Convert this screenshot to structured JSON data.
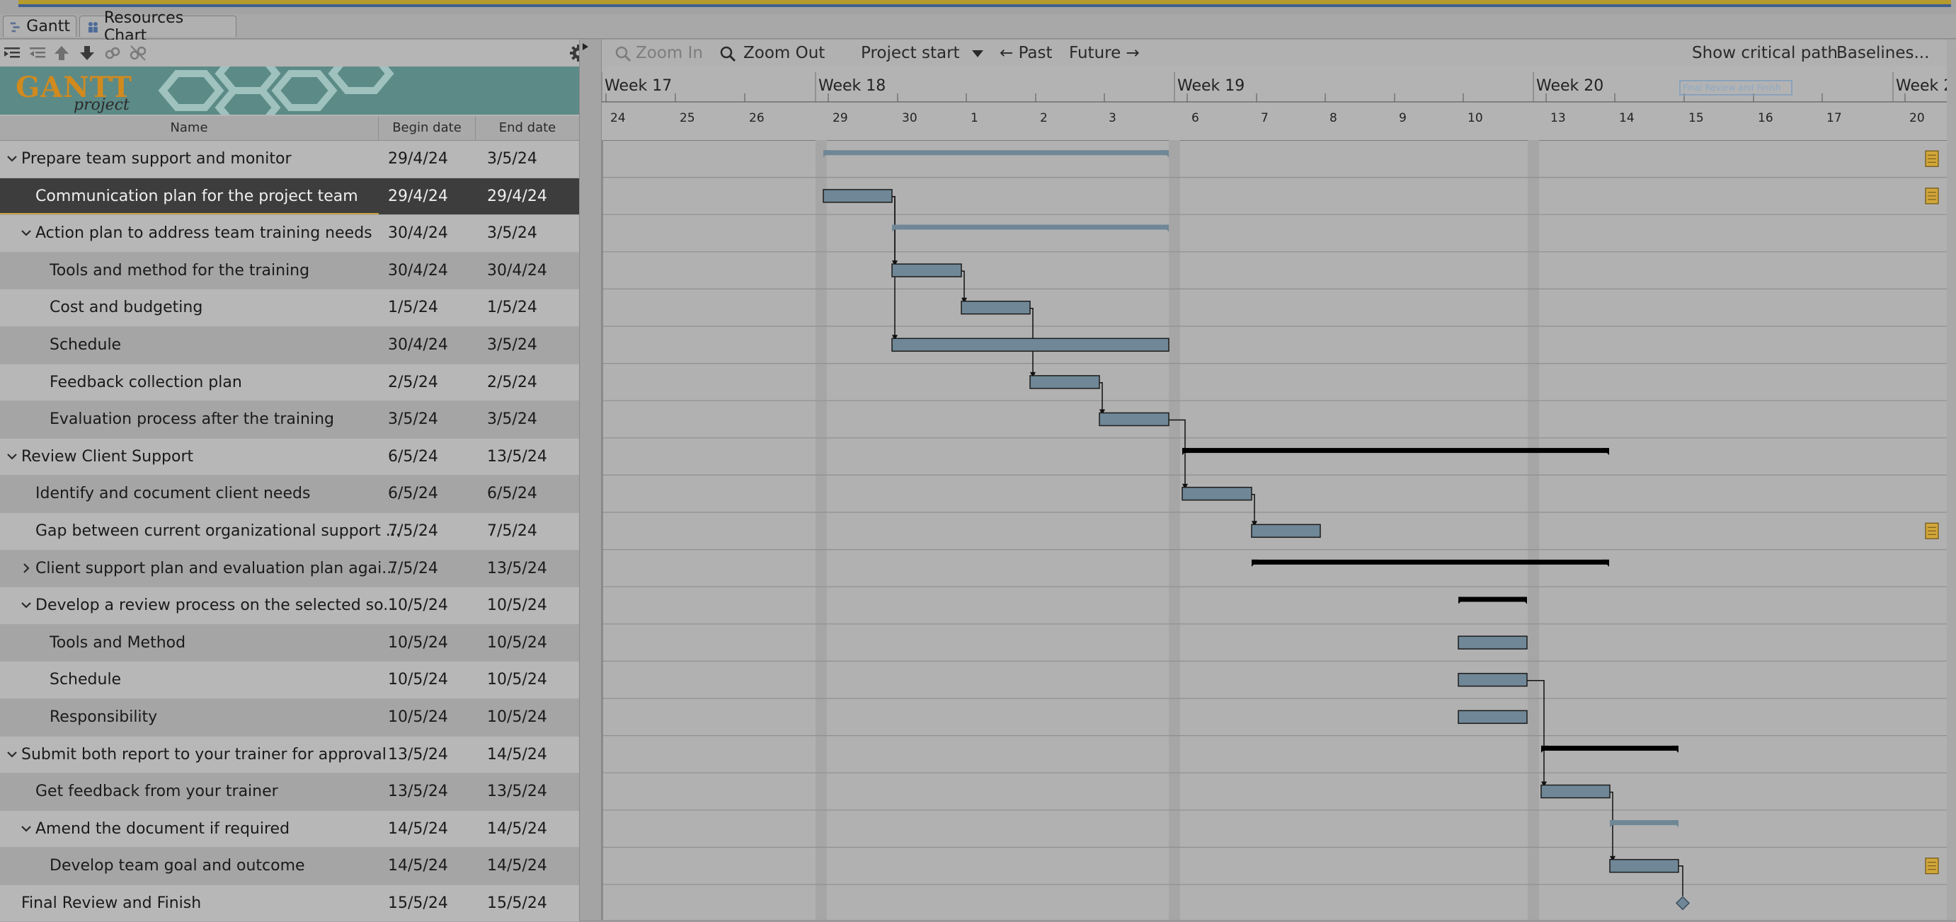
{
  "tabs": [
    {
      "label": "Gantt",
      "icon": "gantt-icon"
    },
    {
      "label": "Resources Chart",
      "icon": "resources-icon"
    }
  ],
  "toolbar": {
    "icons": [
      "indent-icon",
      "outdent-icon",
      "move-up-icon",
      "move-down-icon",
      "link-icon",
      "unlink-icon"
    ],
    "settings_icon": "gear-icon"
  },
  "logo": {
    "word": "GANTT",
    "sub": "project"
  },
  "columns": {
    "name": "Name",
    "begin": "Begin date",
    "end": "End date"
  },
  "tasks": [
    {
      "name": "Prepare team support and monitor",
      "begin": "29/4/24",
      "end": "3/5/24",
      "level": 0,
      "expander": "down",
      "selected": false
    },
    {
      "name": "Communication plan for the project team",
      "begin": "29/4/24",
      "end": "29/4/24",
      "level": 1,
      "expander": "none",
      "selected": true
    },
    {
      "name": "Action plan to address team training needs",
      "begin": "30/4/24",
      "end": "3/5/24",
      "level": 1,
      "expander": "down",
      "selected": false
    },
    {
      "name": "Tools and method for the training",
      "begin": "30/4/24",
      "end": "30/4/24",
      "level": 2,
      "expander": "none",
      "selected": false
    },
    {
      "name": "Cost and budgeting",
      "begin": "1/5/24",
      "end": "1/5/24",
      "level": 2,
      "expander": "none",
      "selected": false
    },
    {
      "name": "Schedule",
      "begin": "30/4/24",
      "end": "3/5/24",
      "level": 2,
      "expander": "none",
      "selected": false
    },
    {
      "name": "Feedback collection plan",
      "begin": "2/5/24",
      "end": "2/5/24",
      "level": 2,
      "expander": "none",
      "selected": false
    },
    {
      "name": "Evaluation process after the training",
      "begin": "3/5/24",
      "end": "3/5/24",
      "level": 2,
      "expander": "none",
      "selected": false
    },
    {
      "name": "Review Client Support",
      "begin": "6/5/24",
      "end": "13/5/24",
      "level": 0,
      "expander": "down",
      "selected": false
    },
    {
      "name": "Identify and cocument client needs",
      "begin": "6/5/24",
      "end": "6/5/24",
      "level": 1,
      "expander": "none",
      "selected": false
    },
    {
      "name": "Gap between current organizational support ...",
      "begin": "7/5/24",
      "end": "7/5/24",
      "level": 1,
      "expander": "none",
      "selected": false
    },
    {
      "name": "Client support plan and evaluation plan agai...",
      "begin": "7/5/24",
      "end": "13/5/24",
      "level": 1,
      "expander": "right",
      "selected": false
    },
    {
      "name": "Develop a review process on the selected so...",
      "begin": "10/5/24",
      "end": "10/5/24",
      "level": 1,
      "expander": "down",
      "selected": false
    },
    {
      "name": "Tools and Method",
      "begin": "10/5/24",
      "end": "10/5/24",
      "level": 2,
      "expander": "none",
      "selected": false
    },
    {
      "name": "Schedule",
      "begin": "10/5/24",
      "end": "10/5/24",
      "level": 2,
      "expander": "none",
      "selected": false
    },
    {
      "name": "Responsibility",
      "begin": "10/5/24",
      "end": "10/5/24",
      "level": 2,
      "expander": "none",
      "selected": false
    },
    {
      "name": "Submit both report to your trainer for approval",
      "begin": "13/5/24",
      "end": "14/5/24",
      "level": 0,
      "expander": "down",
      "selected": false
    },
    {
      "name": "Get feedback from your trainer",
      "begin": "13/5/24",
      "end": "13/5/24",
      "level": 1,
      "expander": "none",
      "selected": false
    },
    {
      "name": "Amend the document if required",
      "begin": "14/5/24",
      "end": "14/5/24",
      "level": 1,
      "expander": "down",
      "selected": false
    },
    {
      "name": "Develop team goal and outcome",
      "begin": "14/5/24",
      "end": "14/5/24",
      "level": 2,
      "expander": "none",
      "selected": false
    },
    {
      "name": "Final Review and Finish",
      "begin": "15/5/24",
      "end": "15/5/24",
      "level": 0,
      "expander": "none",
      "selected": false
    }
  ],
  "chart_toolbar": {
    "zoom_in": "Zoom In",
    "zoom_out": "Zoom Out",
    "project_start": "Project start",
    "past": "← Past",
    "future": "Future →",
    "critical_path": "Show critical path",
    "baselines": "Baselines..."
  },
  "weeks": [
    "Week 17",
    "Week 18",
    "Week 19",
    "Week 20",
    "Week 2"
  ],
  "days": [
    "24",
    "25",
    "26",
    "29",
    "30",
    "1",
    "2",
    "3",
    "6",
    "7",
    "8",
    "9",
    "10",
    "13",
    "14",
    "15",
    "16",
    "17",
    "20"
  ],
  "timeline_marker": "Final Review and Finish",
  "notes_rows": [
    0,
    1,
    10,
    19
  ],
  "colors": {
    "task_bar": "#6f8796",
    "summary_bar": "#000000",
    "selected_row": "#3d3d3d",
    "note": "#d1a63a"
  }
}
